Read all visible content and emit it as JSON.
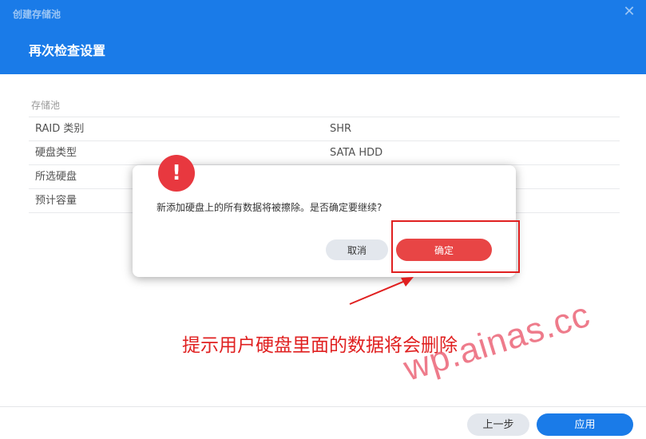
{
  "window": {
    "title": "创建存储池",
    "close_glyph": "✕",
    "page_title": "再次检查设置"
  },
  "summary": {
    "section": "存储池",
    "rows": [
      {
        "key": "RAID 类别",
        "value": "SHR"
      },
      {
        "key": "硬盘类型",
        "value": "SATA HDD"
      },
      {
        "key": "所选硬盘",
        "value": ""
      },
      {
        "key": "预计容量",
        "value": ""
      }
    ]
  },
  "dialog": {
    "icon_glyph": "!",
    "message": "新添加硬盘上的所有数据将被擦除。是否确定要继续?",
    "cancel_label": "取消",
    "confirm_label": "确定"
  },
  "annotation": {
    "text": "提示用户硬盘里面的数据将会删除",
    "color": "#e02020"
  },
  "watermark": {
    "text": "wp.ainas.cc"
  },
  "footer": {
    "prev_label": "上一步",
    "apply_label": "应用"
  },
  "colors": {
    "header": "#1a7be8",
    "danger": "#e84545",
    "primary": "#1a7be8"
  }
}
